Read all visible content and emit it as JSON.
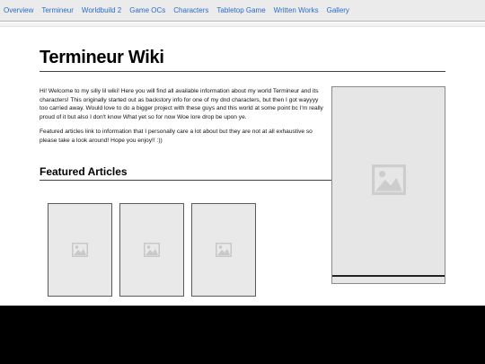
{
  "nav": {
    "items": [
      {
        "label": "Overview"
      },
      {
        "label": "Termineur"
      },
      {
        "label": "Worldbuild 2"
      },
      {
        "label": "Game OCs"
      },
      {
        "label": "Characters"
      },
      {
        "label": "Tabletop Game"
      },
      {
        "label": "Written Works"
      },
      {
        "label": "Gallery"
      }
    ]
  },
  "main": {
    "title": "Termineur Wiki",
    "intro_paragraphs": [
      "Hi! Welcome to my silly lil wiki! Here you will find all available information about my world Termineur and its characters! This originally started out as backstory info for one of my dnd characters, but then I got wayyyy too carried away. Would love to do a bigger project with these guys and this world at some point bc I'm really proud of it but also I don't know What yet so for now Woe lore drop be upon ye.",
      "Featured articles link to information that I personally care a lot about but they are not at all exhaustive so please take a look around! Hope you enjoy!! :))"
    ],
    "featured_heading": "Featured Articles",
    "featured_cards": [
      {
        "icon": "image-placeholder-icon"
      },
      {
        "icon": "image-placeholder-icon"
      },
      {
        "icon": "image-placeholder-icon"
      }
    ]
  },
  "sidebar": {
    "image_icon": "image-placeholder-icon"
  },
  "colors": {
    "nav_link": "#2a6bc9",
    "nav_bg": "#ebebeb",
    "placeholder_bg": "#e6e6e6",
    "placeholder_icon": "#c8c8c8"
  }
}
